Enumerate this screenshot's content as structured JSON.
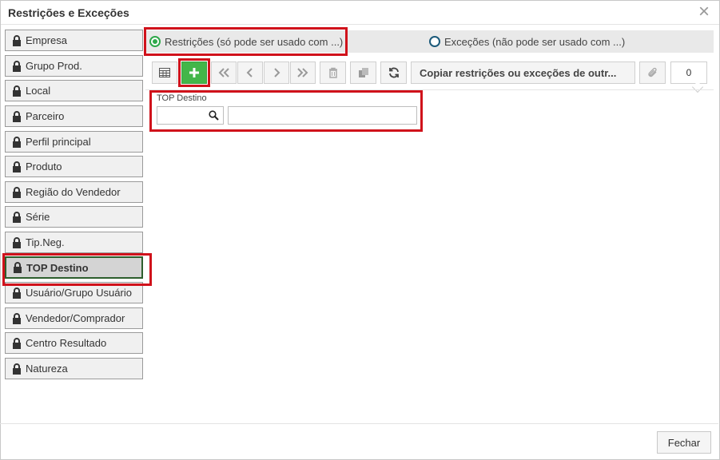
{
  "dialog": {
    "title": "Restrições e Exceções",
    "close_icon": "close-icon"
  },
  "sidebar": {
    "items": [
      {
        "label": "Empresa",
        "active": false
      },
      {
        "label": "Grupo Prod.",
        "active": false
      },
      {
        "label": "Local",
        "active": false
      },
      {
        "label": "Parceiro",
        "active": false
      },
      {
        "label": "Perfil principal",
        "active": false
      },
      {
        "label": "Produto",
        "active": false
      },
      {
        "label": "Região do Vendedor",
        "active": false
      },
      {
        "label": "Série",
        "active": false
      },
      {
        "label": "Tip.Neg.",
        "active": false
      },
      {
        "label": "TOP Destino",
        "active": true
      },
      {
        "label": "Usuário/Grupo Usuário",
        "active": false
      },
      {
        "label": "Vendedor/Comprador",
        "active": false
      },
      {
        "label": "Centro Resultado",
        "active": false
      },
      {
        "label": "Natureza",
        "active": false
      }
    ]
  },
  "mode": {
    "restricoes_label": "Restrições (só pode ser usado com ...)",
    "excecoes_label": "Exceções (não pode ser usado com ...)",
    "selected": "restricoes"
  },
  "toolbar": {
    "copy_label": "Copiar restrições ou exceções de outr...",
    "attachment_count": "0"
  },
  "filter": {
    "label": "TOP Destino",
    "code_value": "",
    "description_value": ""
  },
  "footer": {
    "close_label": "Fechar"
  },
  "colors": {
    "highlight": "#d0121b",
    "add_green": "#43b649",
    "radio_green": "#2ea84a"
  }
}
